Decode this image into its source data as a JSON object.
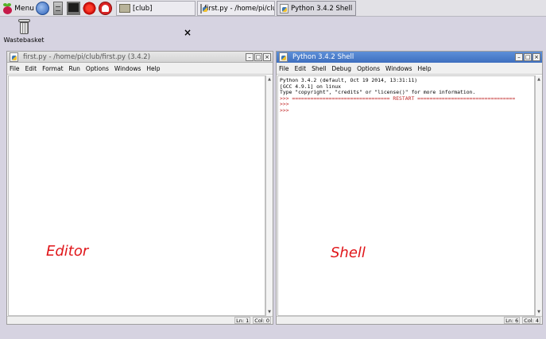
{
  "taskbar": {
    "menu_label": "Menu",
    "launchers": [
      {
        "icon": "globe-icon"
      },
      {
        "icon": "file-cabinet-icon"
      },
      {
        "icon": "terminal-icon"
      },
      {
        "icon": "mathematica-icon"
      },
      {
        "icon": "wolfram-icon"
      }
    ],
    "tasks": [
      {
        "label": "[club]",
        "icon": "folder-icon"
      },
      {
        "label": "first.py - /home/pi/clu",
        "icon": "python-icon"
      },
      {
        "label": "Python 3.4.2 Shell",
        "icon": "python-icon"
      }
    ]
  },
  "desktop": {
    "wastebasket_label": "Wastebasket",
    "stray_close": "×"
  },
  "editor": {
    "title": "first.py - /home/pi/club/first.py (3.4.2)",
    "menus": [
      "File",
      "Edit",
      "Format",
      "Run",
      "Options",
      "Windows",
      "Help"
    ],
    "status": {
      "line": "Ln: 1",
      "col": "Col: 0"
    },
    "controls": {
      "minimize": "–",
      "maximize": "□",
      "close": "×"
    }
  },
  "shell": {
    "title": "Python 3.4.2 Shell",
    "menus": [
      "File",
      "Edit",
      "Shell",
      "Debug",
      "Options",
      "Windows",
      "Help"
    ],
    "lines": [
      "Python 3.4.2 (default, Oct 19 2014, 13:31:11)",
      "[GCC 4.9.1] on linux",
      "Type \"copyright\", \"credits\" or \"license()\" for more information.",
      ">>> ================================ RESTART ================================",
      ">>>",
      ">>>"
    ],
    "status": {
      "line": "Ln: 6",
      "col": "Col: 4"
    },
    "controls": {
      "minimize": "–",
      "maximize": "□",
      "close": "×"
    }
  },
  "annotations": {
    "editor_label": "Editor",
    "shell_label": "Shell",
    "color": "#e0161a"
  },
  "colors": {
    "desktop_bg": "#d6d3e1",
    "shell_titlebar": "#4a7ccb",
    "prompt": "#c22a2a"
  }
}
